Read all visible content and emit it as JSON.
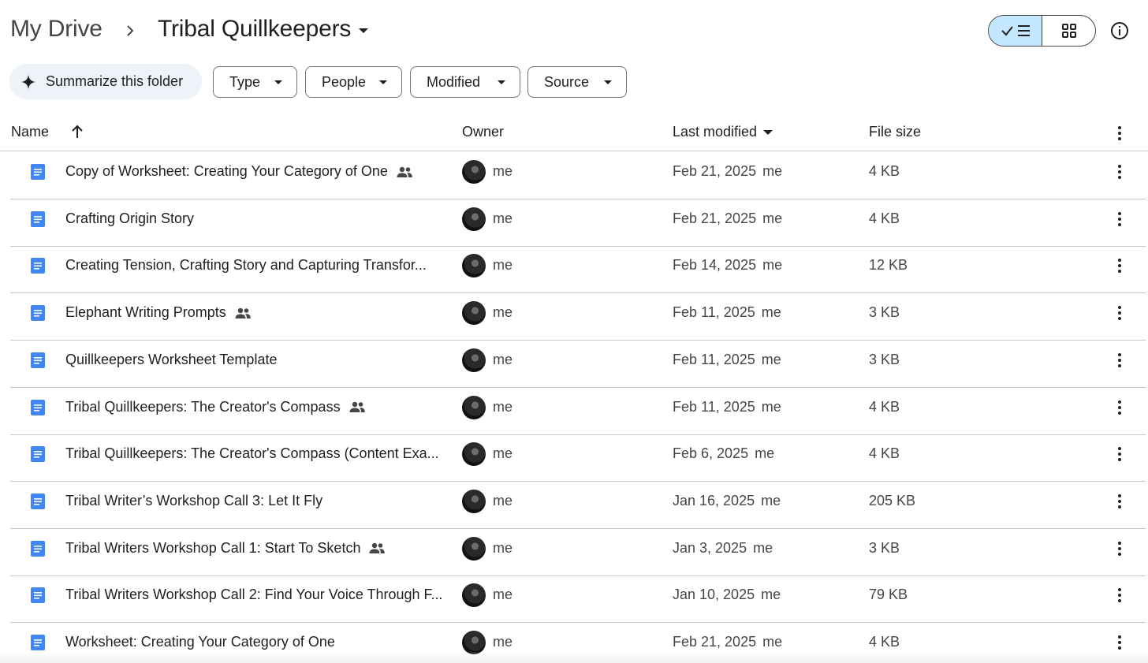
{
  "breadcrumb": {
    "root": "My Drive",
    "current": "Tribal Quillkeepers"
  },
  "toolbar": {
    "summarize_label": "Summarize this folder",
    "filters": [
      "Type",
      "People",
      "Modified",
      "Source"
    ]
  },
  "columns": {
    "name": "Name",
    "owner": "Owner",
    "last_modified": "Last modified",
    "file_size": "File size"
  },
  "files": [
    {
      "name": "Copy of Worksheet: Creating Your Category of One",
      "shared": true,
      "owner": "me",
      "date": "Feb 21, 2025",
      "by": "me",
      "size": "4 KB"
    },
    {
      "name": "Crafting Origin Story",
      "shared": false,
      "owner": "me",
      "date": "Feb 21, 2025",
      "by": "me",
      "size": "4 KB"
    },
    {
      "name": "Creating Tension, Crafting Story and Capturing Transfor...",
      "shared": false,
      "owner": "me",
      "date": "Feb 14, 2025",
      "by": "me",
      "size": "12 KB"
    },
    {
      "name": "Elephant Writing Prompts",
      "shared": true,
      "owner": "me",
      "date": "Feb 11, 2025",
      "by": "me",
      "size": "3 KB"
    },
    {
      "name": "Quillkeepers Worksheet Template",
      "shared": false,
      "owner": "me",
      "date": "Feb 11, 2025",
      "by": "me",
      "size": "3 KB"
    },
    {
      "name": "Tribal Quillkeepers: The Creator's Compass",
      "shared": true,
      "owner": "me",
      "date": "Feb 11, 2025",
      "by": "me",
      "size": "4 KB"
    },
    {
      "name": "Tribal Quillkeepers: The Creator's Compass (Content Exa...",
      "shared": false,
      "owner": "me",
      "date": "Feb 6, 2025",
      "by": "me",
      "size": "4 KB"
    },
    {
      "name": "Tribal Writer’s Workshop Call 3: Let It Fly",
      "shared": false,
      "owner": "me",
      "date": "Jan 16, 2025",
      "by": "me",
      "size": "205 KB"
    },
    {
      "name": "Tribal Writers Workshop Call 1: Start To Sketch",
      "shared": true,
      "owner": "me",
      "date": "Jan 3, 2025",
      "by": "me",
      "size": "3 KB"
    },
    {
      "name": "Tribal Writers Workshop Call 2: Find Your Voice Through F...",
      "shared": false,
      "owner": "me",
      "date": "Jan 10, 2025",
      "by": "me",
      "size": "79 KB"
    },
    {
      "name": "Worksheet: Creating Your Category of One",
      "shared": false,
      "owner": "me",
      "date": "Feb 21, 2025",
      "by": "me",
      "size": "4 KB"
    }
  ],
  "colors": {
    "doc_blue": "#4285f4",
    "toggle_active": "#c2e7ff",
    "summarize_bg": "#eef2f9",
    "divider": "#c4c7c5"
  },
  "icons": {
    "sort": "arrow-up-icon",
    "file": "google-docs-icon",
    "shared": "people-icon",
    "more": "more-vert-icon",
    "info": "info-icon",
    "list_view": "list-view-icon",
    "grid_view": "grid-view-icon",
    "sparkle": "sparkle-icon"
  }
}
